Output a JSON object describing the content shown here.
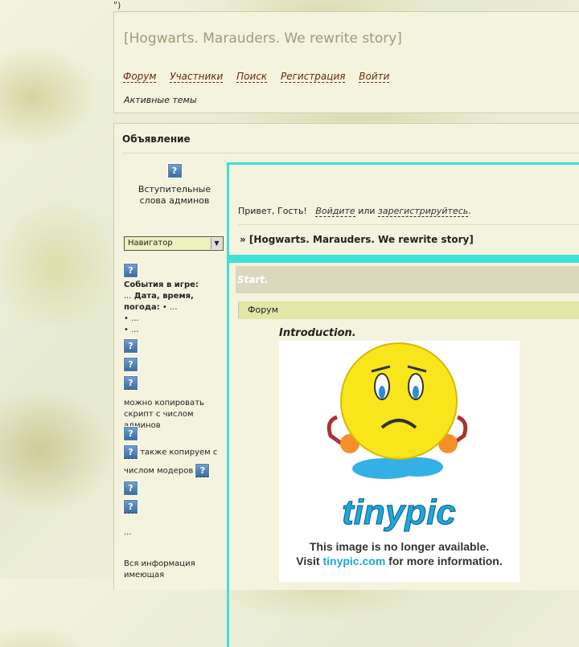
{
  "top_junk": "\")",
  "header": {
    "title": "[Hogwarts. Marauders. We rewrite story]",
    "nav": [
      "Форум",
      "Участники",
      "Поиск",
      "Регистрация",
      "Войти"
    ],
    "active_topics": "Активные темы"
  },
  "announcement": {
    "title": "Объявление"
  },
  "sidebar": {
    "intro_text": "Вступительные слова админов",
    "navigator": "Навигатор",
    "events_title": "События в игре:",
    "events_line2_prefix": "... ",
    "events_line2_bold": "Дата, время,",
    "events_line3_bold": "погода:",
    "events_line3_rest": " • ...",
    "bullet1": "• ...",
    "bullet2": "• ...",
    "copy_text": "можно копировать скрипт с числом админов",
    "copy_text2": "также копируем с",
    "copy_text3": "числом модеров",
    "dots": "...",
    "info_text": "Вся информация имеющая"
  },
  "content": {
    "greeting_prefix": "Привет, Гость!",
    "login_link": "Войдите",
    "or": "или",
    "register_link": "зарегистрируйтесь",
    "period": ".",
    "breadcrumb": "» [Hogwarts. Marauders. We rewrite story]",
    "start": "Start.",
    "forum_label": "Форум",
    "intro_title": "Introduction.",
    "image_text1": "This image is no longer available.",
    "image_text2_prefix": "Visit ",
    "image_text2_link": "tinypic.com",
    "image_text2_suffix": " for more information.",
    "tinypic_logo": "tinypic"
  },
  "colors": {
    "accent_cyan": "#3ee0d8",
    "nav_link": "#6b2a10",
    "title": "#a39a78"
  }
}
